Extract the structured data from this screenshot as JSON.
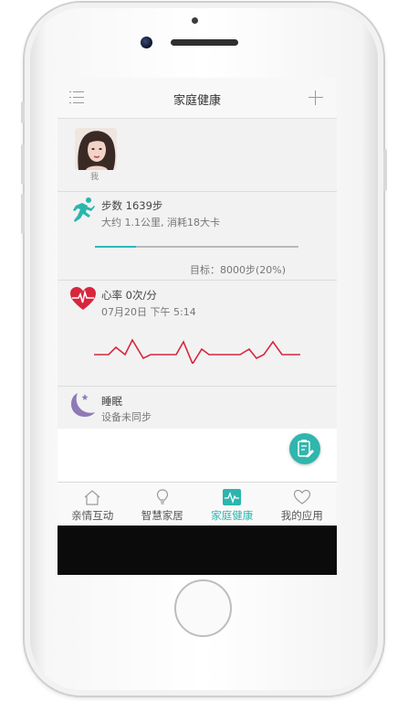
{
  "header": {
    "title": "家庭健康"
  },
  "profile": {
    "name": "我"
  },
  "steps": {
    "title": "步数 1639步",
    "detail": "大约 1.1公里, 消耗18大卡",
    "goal": "目标：8000步(20%)",
    "progress_percent": 20
  },
  "heart": {
    "title": "心率 0次/分",
    "time": "07月20日 下午 5:14"
  },
  "sleep": {
    "title": "睡眠",
    "status": "设备未同步"
  },
  "tabs": [
    {
      "label": "亲情互动",
      "icon": "home-icon",
      "active": false
    },
    {
      "label": "智慧家居",
      "icon": "bulb-icon",
      "active": false
    },
    {
      "label": "家庭健康",
      "icon": "pulse-icon",
      "active": true
    },
    {
      "label": "我的应用",
      "icon": "heart-outline-icon",
      "active": false
    }
  ],
  "colors": {
    "accent": "#2bb5ad",
    "heart_red": "#d7263d",
    "moon_purple": "#8e7ab5"
  }
}
